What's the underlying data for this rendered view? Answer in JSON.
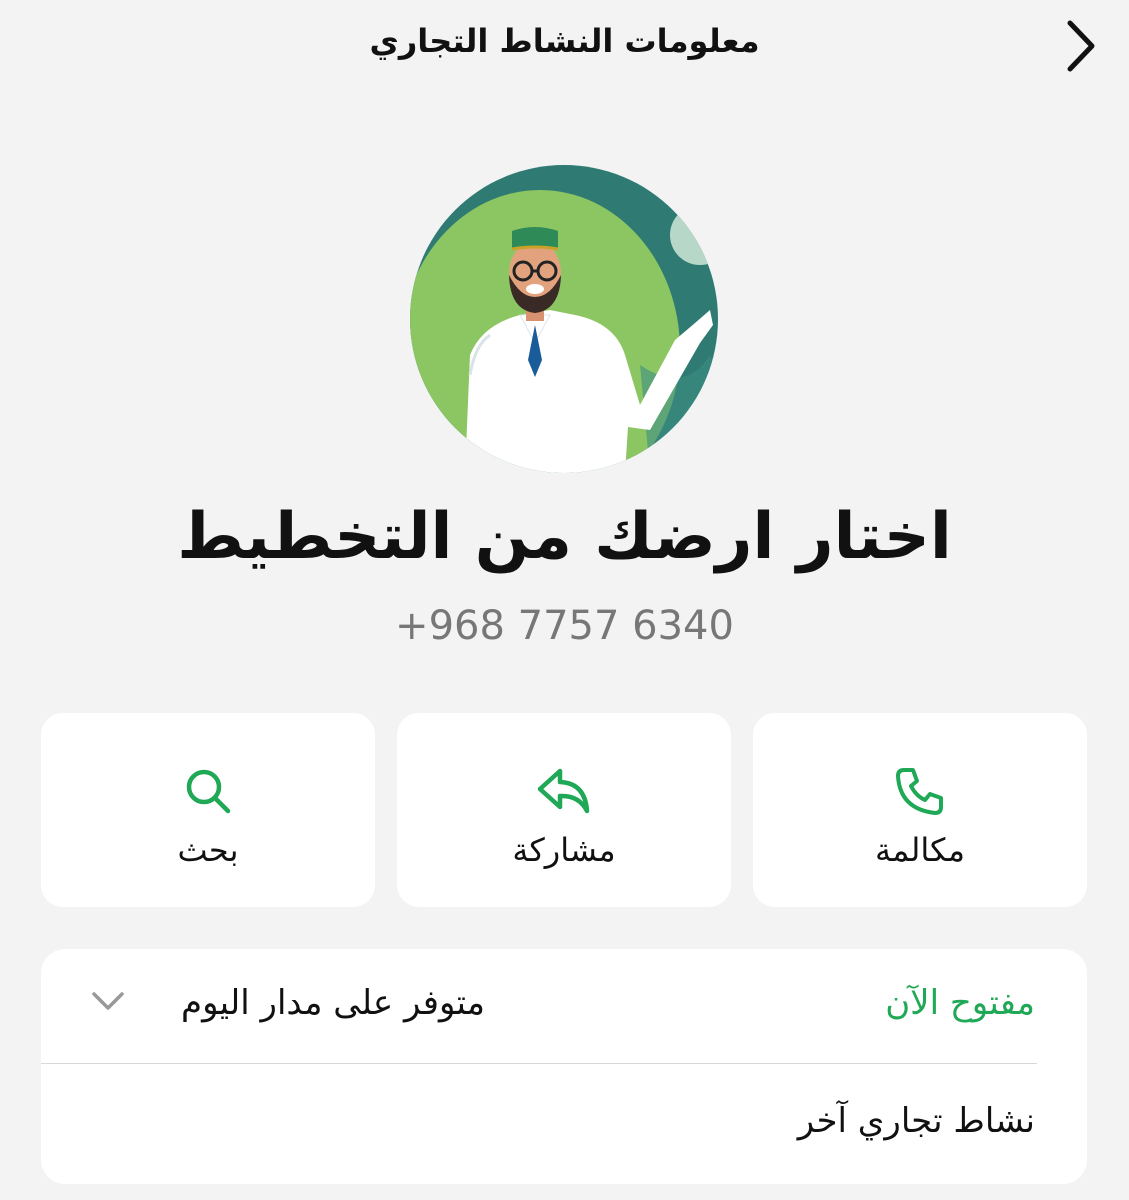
{
  "header": {
    "title": "معلومات النشاط التجاري",
    "back_icon": "chevron-right-icon"
  },
  "profile": {
    "name": "اختار ارضك من التخطيط",
    "phone": "+968 7757 6340",
    "avatar": "avatar-illustration"
  },
  "actions": [
    {
      "label": "بحث",
      "icon": "search-icon"
    },
    {
      "label": "مشاركة",
      "icon": "share-icon"
    },
    {
      "label": "مكالمة",
      "icon": "phone-icon"
    }
  ],
  "hours": {
    "status": "مفتوح الآن",
    "schedule": "متوفر على مدار اليوم",
    "expand_icon": "chevron-down-icon"
  },
  "other_business": {
    "label": "نشاط تجاري آخر"
  },
  "colors": {
    "accent_green": "#1fa855",
    "background": "#f3f3f3",
    "card": "#ffffff",
    "secondary_text": "#777777"
  }
}
